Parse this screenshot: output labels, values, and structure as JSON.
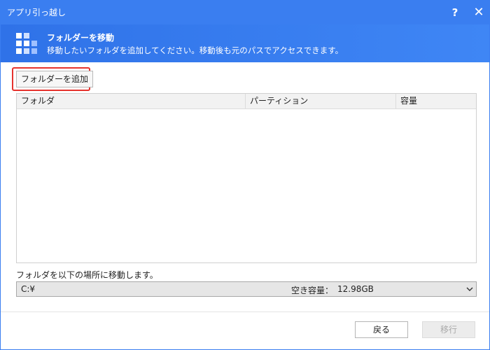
{
  "window": {
    "title": "アプリ引っ越し"
  },
  "titlebar": {
    "help_glyph": "?",
    "close_glyph": "✕"
  },
  "header": {
    "title": "フォルダーを移動",
    "subtitle": "移動したいフォルダを追加してください。移動後も元のパスでアクセスできます。",
    "logo_icon": "grid-blocks-icon"
  },
  "toolbar": {
    "add_label": "フォルダーを追加"
  },
  "table": {
    "columns": [
      "フォルダ",
      "パーティション",
      "容量"
    ],
    "rows": []
  },
  "destination": {
    "label": "フォルダを以下の場所に移動します。",
    "drive": "C:¥",
    "free_label": "空き容量：",
    "free_value": "12.98GB"
  },
  "footer": {
    "back_label": "戻る",
    "migrate_label": "移行",
    "migrate_enabled": false
  },
  "colors": {
    "accent": "#3a7ef0",
    "highlight": "#e5322d"
  }
}
